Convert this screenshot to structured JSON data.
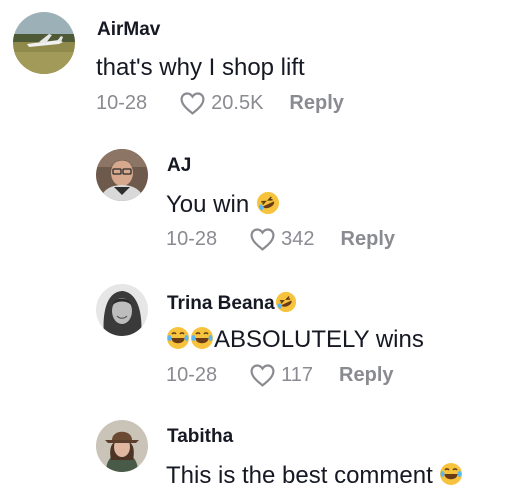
{
  "comments": [
    {
      "username": "AirMav",
      "text": "that's why I shop lift",
      "date": "10-28",
      "likes": "20.5K",
      "reply_label": "Reply",
      "avatar_icon": "airplane-field-avatar"
    },
    {
      "username": "AJ",
      "text": "You win ",
      "text_emoji": "rolling-on-floor-laughing-emoji",
      "date": "10-28",
      "likes": "342",
      "reply_label": "Reply",
      "avatar_icon": "man-portrait-avatar"
    },
    {
      "username": "Trina Beana",
      "username_emoji": "rolling-on-floor-laughing-emoji",
      "text": "ABSOLUTELY wins",
      "text_emoji": "face-with-tears-of-joy-emoji x2",
      "date": "10-28",
      "likes": "117",
      "reply_label": "Reply",
      "avatar_icon": "woman-bw-portrait-avatar"
    },
    {
      "username": "Tabitha",
      "text": "This is the best comment ",
      "text_emoji": "face-with-tears-of-joy-emoji",
      "avatar_icon": "woman-hat-portrait-avatar"
    }
  ],
  "colors": {
    "text": "#161823",
    "meta": "#8a8b91",
    "emoji_yellow": "#f7c23c"
  }
}
